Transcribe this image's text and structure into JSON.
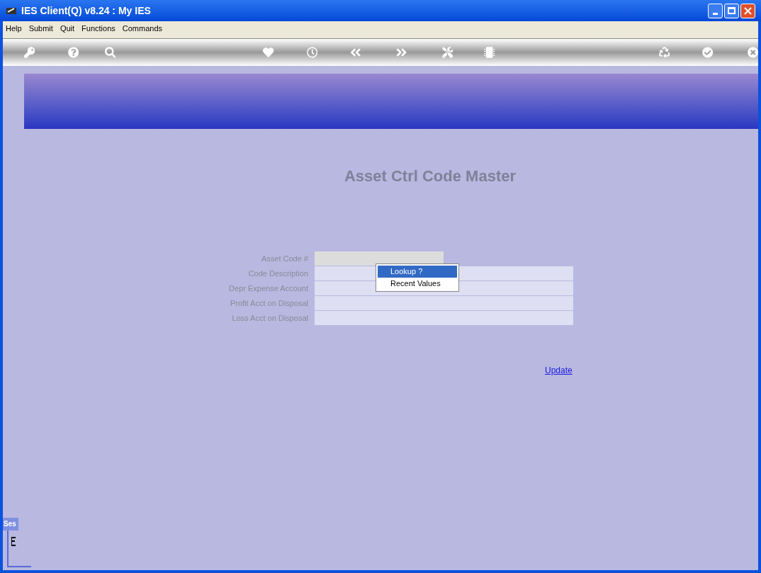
{
  "window": {
    "title": "IES Client(Q) v8.24 : My IES"
  },
  "menu": [
    "Help",
    "Submit",
    "Quit",
    "Functions",
    "Commands"
  ],
  "page_title": "Asset Ctrl Code Master",
  "fields": [
    {
      "label": "Asset Code #",
      "kind": "key"
    },
    {
      "label": "Code Description",
      "kind": "text"
    },
    {
      "label": "Depr Expense Account",
      "kind": "text"
    },
    {
      "label": "Profit Acct on Disposal",
      "kind": "text"
    },
    {
      "label": "Loss Acct on Disposal",
      "kind": "text"
    }
  ],
  "context_menu": [
    {
      "label": "Lookup ?",
      "selected": true
    },
    {
      "label": "Recent Values",
      "selected": false
    }
  ],
  "update_link": "Update",
  "session_tab": "Ses"
}
